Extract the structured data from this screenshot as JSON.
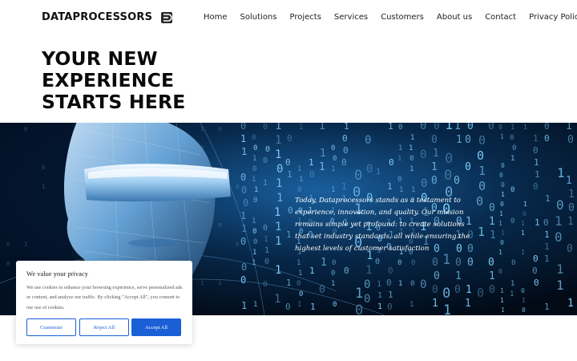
{
  "header": {
    "brand": "DATAPROCESSORS",
    "logo_icon": "dp-logo-icon",
    "nav": [
      {
        "label": "Home"
      },
      {
        "label": "Solutions"
      },
      {
        "label": "Projects"
      },
      {
        "label": "Services"
      },
      {
        "label": "Customers"
      },
      {
        "label": "About us"
      },
      {
        "label": "Contact"
      },
      {
        "label": "Privacy Policy"
      }
    ]
  },
  "headline": {
    "lines": [
      "YOUR NEW",
      "EXPERIENCE",
      "STARTS HERE"
    ]
  },
  "hero": {
    "text": "Today, Dataprocessors stands as a testament to experience, innovation, and quality. Our mission remains simple yet profound: to create solutions that set industry standards, all while ensuring the highest levels of customer satisfaction",
    "image": "cyber-head-binary-code-image"
  },
  "cookie": {
    "title": "We value your privacy",
    "body": "We use cookies to enhance your browsing experience, serve personalized ads or content, and analyze our traffic. By clicking \"Accept All\", you consent to our use of cookies.",
    "customize_label": "Customize",
    "reject_label": "Reject All",
    "accept_label": "Accept All",
    "accent_color": "#1a5fd6"
  }
}
